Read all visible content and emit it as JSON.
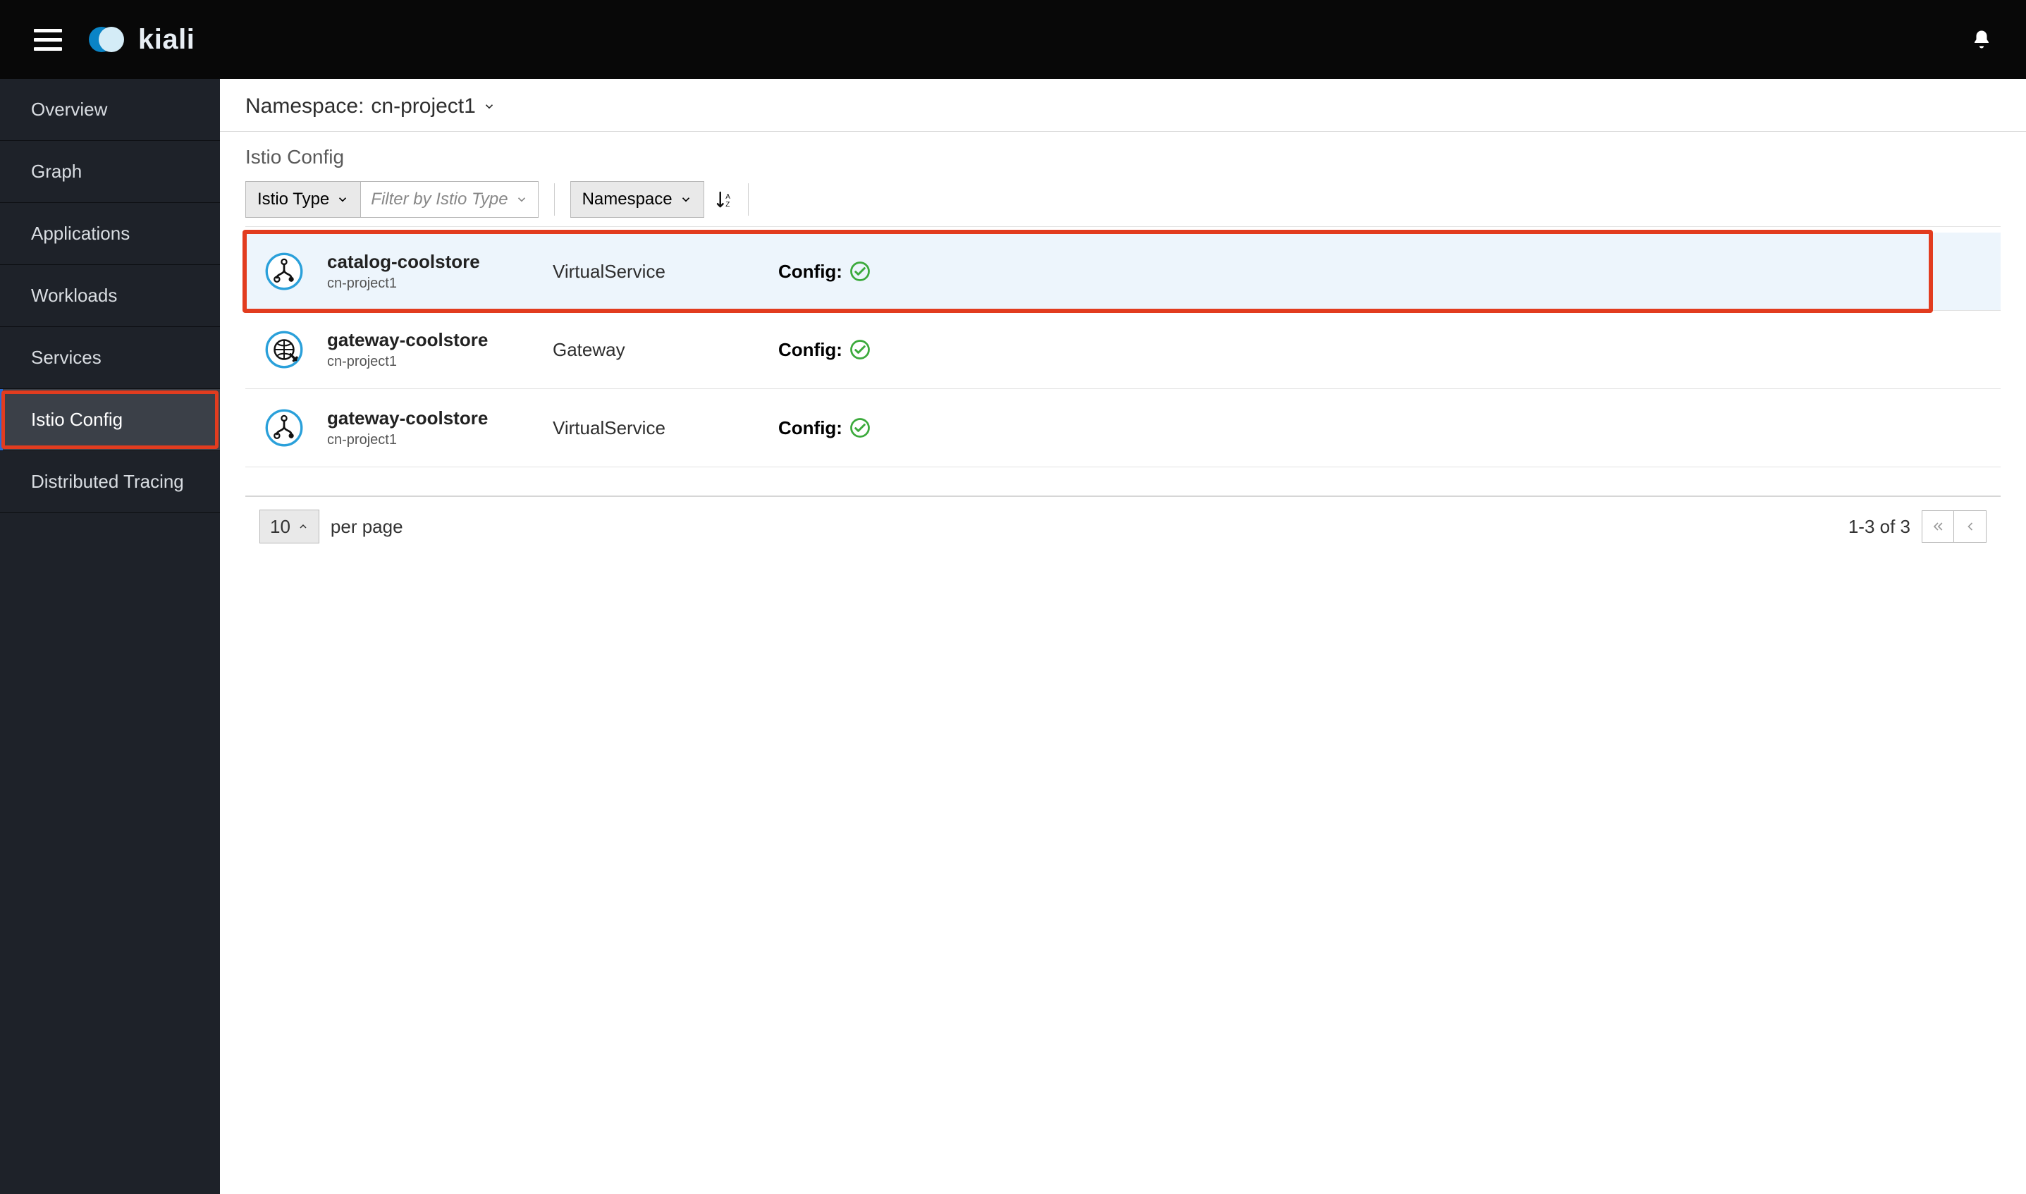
{
  "brand": {
    "name": "kiali"
  },
  "sidebar": {
    "items": [
      {
        "label": "Overview"
      },
      {
        "label": "Graph"
      },
      {
        "label": "Applications"
      },
      {
        "label": "Workloads"
      },
      {
        "label": "Services"
      },
      {
        "label": "Istio Config"
      },
      {
        "label": "Distributed Tracing"
      }
    ],
    "active_index": 5
  },
  "namespace": {
    "label_prefix": "Namespace: ",
    "value": "cn-project1"
  },
  "page": {
    "heading": "Istio Config"
  },
  "toolbar": {
    "filter_type_label": "Istio Type",
    "filter_placeholder": "Filter by Istio Type",
    "sort_by_label": "Namespace"
  },
  "list": {
    "config_label": "Config:",
    "rows": [
      {
        "name": "catalog-coolstore",
        "namespace": "cn-project1",
        "type": "VirtualService",
        "config_status": "ok",
        "icon": "virtualservice",
        "highlight": true
      },
      {
        "name": "gateway-coolstore",
        "namespace": "cn-project1",
        "type": "Gateway",
        "config_status": "ok",
        "icon": "gateway",
        "highlight": false
      },
      {
        "name": "gateway-coolstore",
        "namespace": "cn-project1",
        "type": "VirtualService",
        "config_status": "ok",
        "icon": "virtualservice",
        "highlight": false
      }
    ]
  },
  "pagination": {
    "per_page": "10",
    "per_page_suffix": "per page",
    "range_text": "1-3 of 3"
  },
  "colors": {
    "accent_blue": "#2aa0da",
    "ok_green": "#3caa3c",
    "sketch_red": "#e23c1f"
  }
}
